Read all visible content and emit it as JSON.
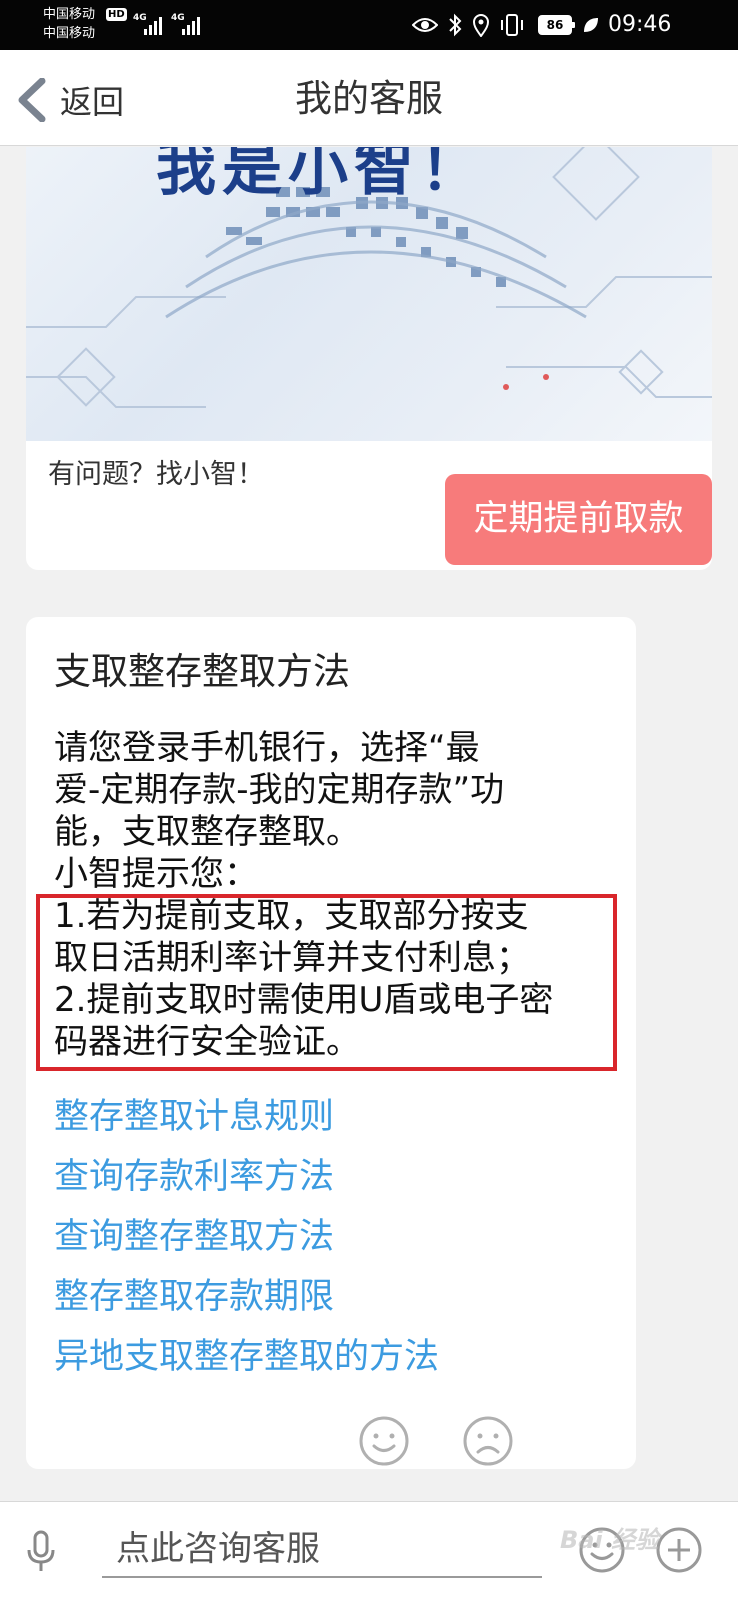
{
  "status_bar": {
    "carrier_1": "中国移动",
    "carrier_2": "中国移动",
    "hd_badge": "HD",
    "network_1": "4G",
    "network_2": "4G",
    "battery": "86",
    "time": "09:46",
    "icons": [
      "eye-icon",
      "bluetooth-icon",
      "location-icon",
      "vibrate-icon",
      "battery-icon",
      "leaf-icon"
    ]
  },
  "nav": {
    "back_label": "返回",
    "title": "我的客服"
  },
  "chat": {
    "welcome": {
      "banner_text": "我是小智！",
      "text": "有问题？找小智！"
    },
    "user_message": "定期提前取款",
    "answer": {
      "title": "支取整存整取方法",
      "lines": [
        "请您登录手机银行，选择“最",
        "爱-定期存款-我的定期存款”功",
        "能，支取整存整取。",
        "小智提示您：",
        "1.若为提前支取，支取部分按支",
        "取日活期利率计算并支付利息；",
        "2.提前支取时需使用U盾或电子密",
        "码器进行安全验证。"
      ],
      "links": [
        "整存整取计息规则",
        "查询存款利率方法",
        "查询整存整取方法",
        "整存整取存款期限",
        "异地支取整存整取的方法"
      ]
    },
    "feedback": [
      "smile-icon",
      "frown-icon"
    ]
  },
  "input_bar": {
    "placeholder": "点此咨询客服",
    "watermark": "Bai 经验"
  },
  "colors": {
    "user_bubble": "#f77b7b",
    "link": "#3c9be0",
    "highlight_border": "#d9262b",
    "background": "#f1f1f1"
  }
}
